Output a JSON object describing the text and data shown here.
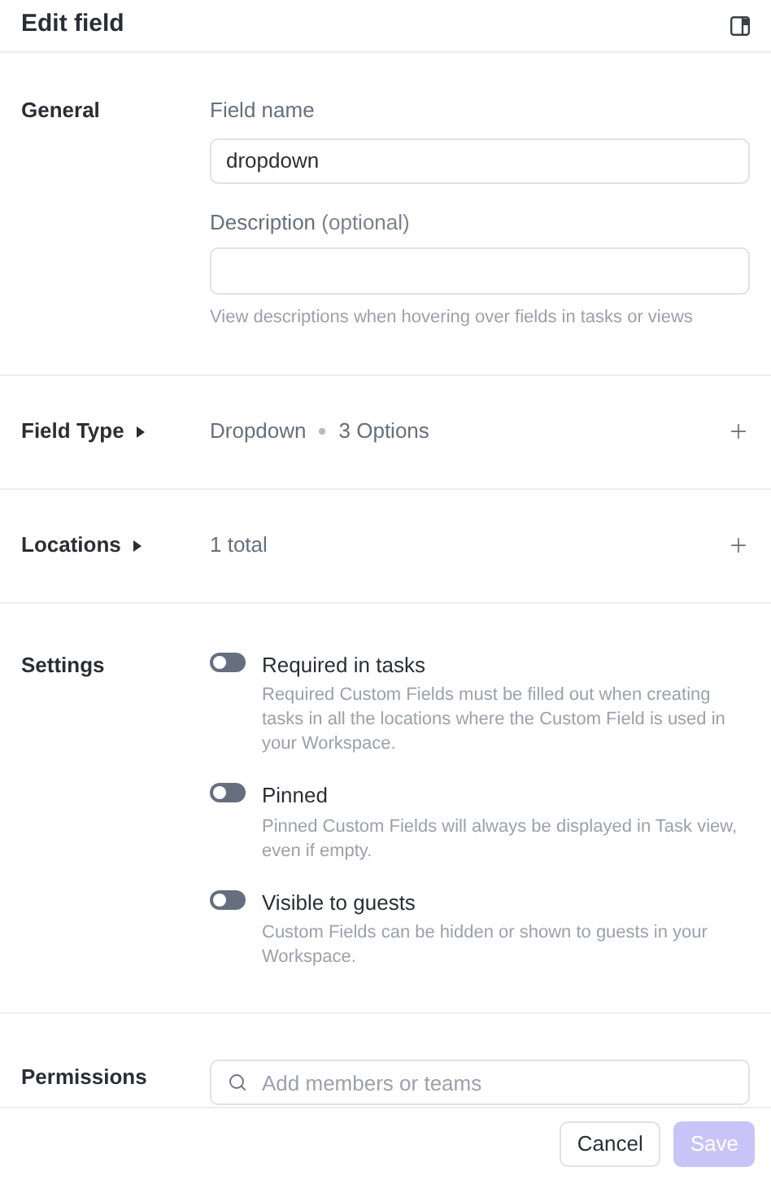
{
  "header": {
    "title": "Edit field"
  },
  "general": {
    "label": "General",
    "field_name": {
      "label": "Field name",
      "value": "dropdown"
    },
    "description": {
      "label": "Description",
      "optional": "(optional)",
      "hint": "View descriptions when hovering over fields in tasks or views"
    }
  },
  "rows": [
    {
      "label": "Field Type",
      "parts": [
        "Dropdown",
        "3 Options"
      ]
    },
    {
      "label": "Locations",
      "parts": [
        "1 total"
      ]
    }
  ],
  "settings": {
    "label": "Settings",
    "toggles": [
      {
        "title": "Required in tasks",
        "description": "Required Custom Fields must be filled out when creating tasks in all the locations where the Custom Field is used in your Workspace.",
        "on": false
      },
      {
        "title": "Pinned",
        "description": "Pinned Custom Fields will always be displayed in Task view, even if empty.",
        "on": false
      },
      {
        "title": "Visible to guests",
        "description": "Custom Fields can be hidden or shown to guests in your Workspace.",
        "on": false
      }
    ]
  },
  "permissions": {
    "label": "Permissions",
    "search": {
      "placeholder": "Add members or teams"
    }
  },
  "footer": {
    "buttons": [
      {
        "label": "Cancel",
        "kind": "secondary",
        "disabled": false
      },
      {
        "label": "Save",
        "kind": "primary",
        "disabled": true
      }
    ]
  }
}
